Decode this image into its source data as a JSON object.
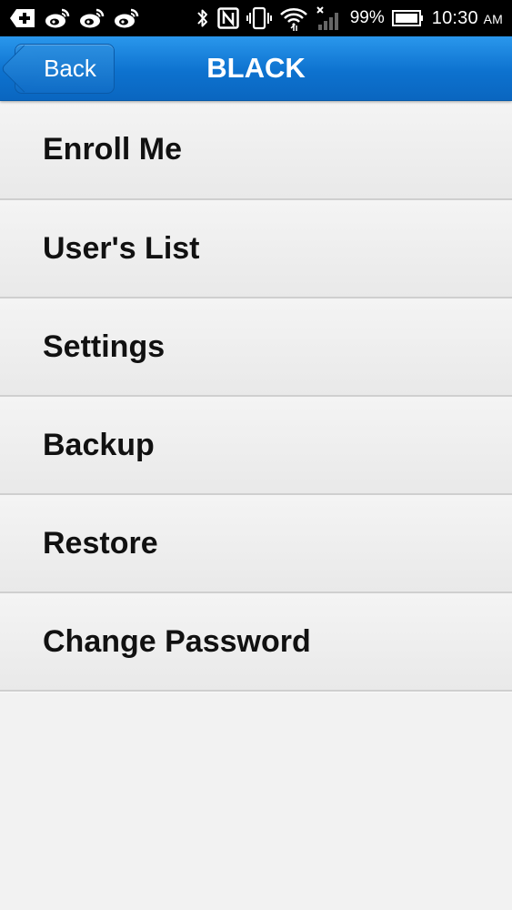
{
  "status_bar": {
    "battery": "99%",
    "time": "10:30",
    "ampm": "AM",
    "icons": [
      "plus-tag-icon",
      "weibo-icon",
      "weibo-icon",
      "weibo-icon",
      "bluetooth-icon",
      "nfc-icon",
      "vibrate-icon",
      "wifi-icon",
      "signal-icon",
      "battery-icon"
    ]
  },
  "nav": {
    "back_label": "Back",
    "title": "BLACK"
  },
  "menu": {
    "items": [
      {
        "label": "Enroll Me"
      },
      {
        "label": "User's List"
      },
      {
        "label": "Settings"
      },
      {
        "label": "Backup"
      },
      {
        "label": "Restore"
      },
      {
        "label": "Change Password"
      }
    ]
  }
}
